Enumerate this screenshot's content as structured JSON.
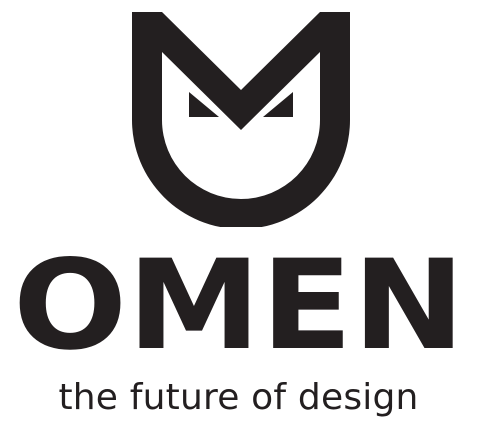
{
  "brand": {
    "name": "OMEN",
    "tagline": "the future of design",
    "color": "#231f20",
    "emblem_icon": "cat-face-m-icon"
  }
}
